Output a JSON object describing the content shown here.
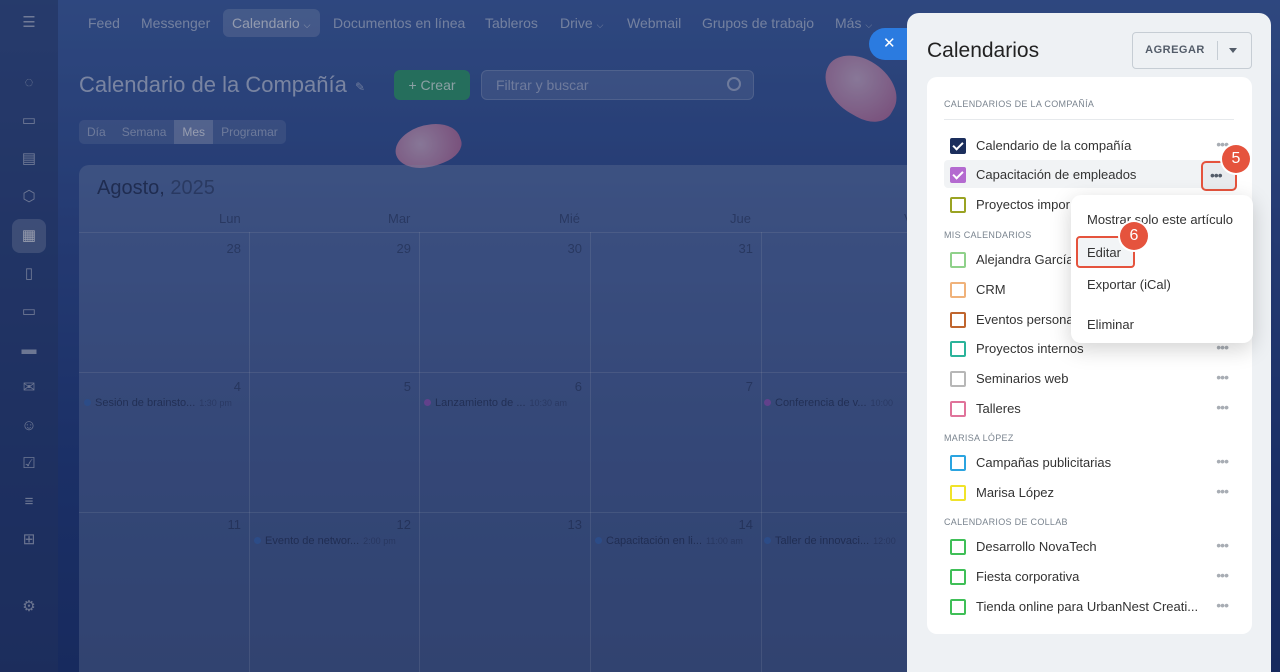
{
  "nav": {
    "items": [
      "Feed",
      "Messenger",
      "Calendario",
      "Documentos en línea",
      "Tableros",
      "Drive",
      "Webmail",
      "Grupos de trabajo",
      "Más"
    ]
  },
  "page": {
    "title": "Calendario de la Compañía",
    "create_label": "+ Crear",
    "search_placeholder": "Filtrar y buscar",
    "views": [
      "Día",
      "Semana",
      "Mes",
      "Programar"
    ]
  },
  "calendar": {
    "month": "Agosto,",
    "year": "2025",
    "weekdays": [
      "Lun",
      "Mar",
      "Mié",
      "Jue",
      "V"
    ],
    "week1": [
      "28",
      "29",
      "30",
      "31",
      "Ag"
    ],
    "week2": [
      "4",
      "5",
      "6",
      "7"
    ],
    "week3": [
      "11",
      "12",
      "13",
      "14"
    ],
    "events": {
      "e1": {
        "name": "Sesión de brainsto...",
        "time": "1:30 pm"
      },
      "e2": {
        "name": "Lanzamiento de ...",
        "time": "10:30 am"
      },
      "e3": {
        "name": "Conferencia de v...",
        "time": "10:00"
      },
      "e4": {
        "name": "Evento de networ...",
        "time": "2:00 pm"
      },
      "e5": {
        "name": "Capacitación en li...",
        "time": "11:00 am"
      },
      "e6": {
        "name": "Taller de innovaci...",
        "time": "12:00"
      }
    }
  },
  "panel": {
    "title": "Calendarios",
    "add_label": "AGREGAR",
    "sections": {
      "company": {
        "label": "CALENDARIOS DE LA COMPAÑÍA",
        "items": [
          {
            "label": "Calendario de la compañía",
            "color": "#1b2e5c",
            "checked": true
          },
          {
            "label": "Capacitación de empleados",
            "color": "#b46ad0",
            "checked": true
          },
          {
            "label": "Proyectos impor",
            "color": "#9aa323",
            "checked": false
          }
        ]
      },
      "mine": {
        "label": "MIS CALENDARIOS",
        "items": [
          {
            "label": "Alejandra García",
            "color": "#8fd18a"
          },
          {
            "label": "CRM",
            "color": "#f0b27a"
          },
          {
            "label": "Eventos persona",
            "color": "#c0652e"
          },
          {
            "label": "Proyectos internos",
            "color": "#2bb39a"
          },
          {
            "label": "Seminarios web",
            "color": "#b7b7b7"
          },
          {
            "label": "Talleres",
            "color": "#e0739a"
          }
        ]
      },
      "marisa": {
        "label": "MARISA LÓPEZ",
        "items": [
          {
            "label": "Campañas publicitarias",
            "color": "#2ba4e0"
          },
          {
            "label": "Marisa López",
            "color": "#f0e32a"
          }
        ]
      },
      "collab": {
        "label": "CALENDARIOS DE COLLAB",
        "items": [
          {
            "label": "Desarrollo NovaTech",
            "color": "#3fbf57"
          },
          {
            "label": "Fiesta corporativa",
            "color": "#3fbf57"
          },
          {
            "label": "Tienda online para UrbanNest Creati...",
            "color": "#3fbf57"
          }
        ]
      }
    }
  },
  "menu": {
    "items": [
      "Mostrar solo este artículo",
      "Editar",
      "Exportar (iCal)",
      "Eliminar"
    ]
  },
  "badges": {
    "step5": "5",
    "step6": "6"
  },
  "colors": {
    "accent": "#2b7be0",
    "highlight": "#e5533d",
    "create": "#2f9a6e"
  }
}
